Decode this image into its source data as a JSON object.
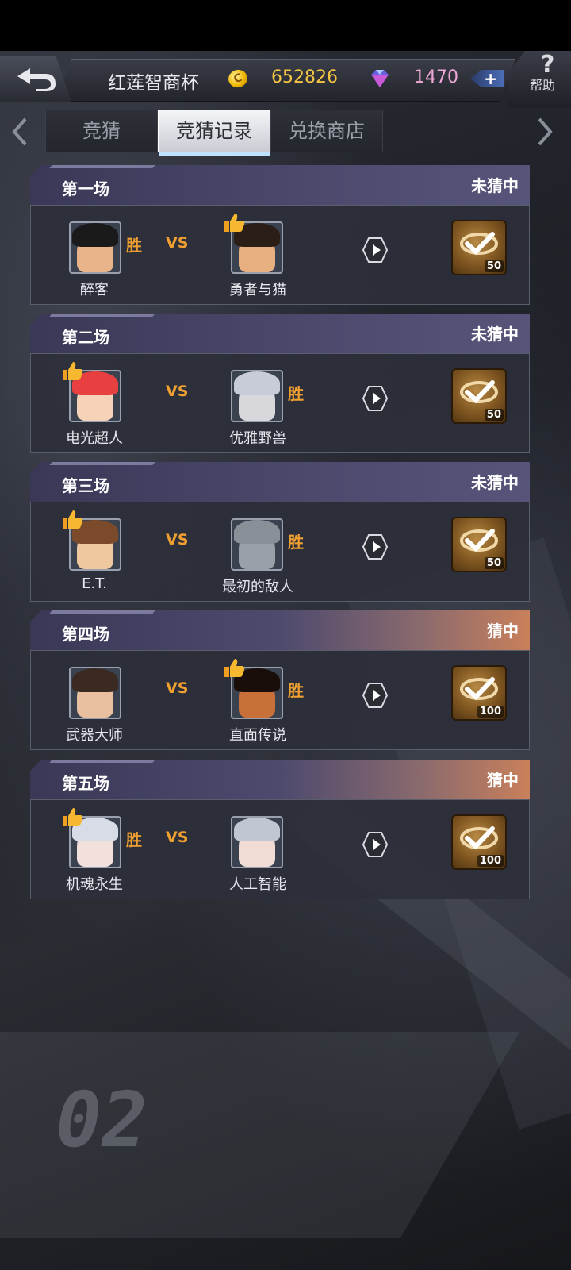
{
  "header": {
    "event_title": "红莲智商杯",
    "coins": "652826",
    "gems": "1470",
    "plus_label": "+",
    "help_label": "帮助",
    "help_symbol": "?"
  },
  "tabs": [
    {
      "label": "竞猜",
      "active": false
    },
    {
      "label": "竞猜记录",
      "active": true
    },
    {
      "label": "兑换商店",
      "active": false
    }
  ],
  "vs_label": "VS",
  "win_label": "胜",
  "matches": [
    {
      "label": "第一场",
      "status": "未猜中",
      "hit": false,
      "team_a": "醉客",
      "team_b": "勇者与猫",
      "winner": "a",
      "pick": "b",
      "reward": "50"
    },
    {
      "label": "第二场",
      "status": "未猜中",
      "hit": false,
      "team_a": "电光超人",
      "team_b": "优雅野兽",
      "winner": "b",
      "pick": "a",
      "reward": "50"
    },
    {
      "label": "第三场",
      "status": "未猜中",
      "hit": false,
      "team_a": "E.T.",
      "team_b": "最初的敌人",
      "winner": "b",
      "pick": "a",
      "reward": "50"
    },
    {
      "label": "第四场",
      "status": "猜中",
      "hit": true,
      "team_a": "武器大师",
      "team_b": "直面传说",
      "winner": "b",
      "pick": "b",
      "reward": "100"
    },
    {
      "label": "第五场",
      "status": "猜中",
      "hit": true,
      "team_a": "机魂永生",
      "team_b": "人工智能",
      "winner": "a",
      "pick": "a",
      "reward": "100"
    }
  ],
  "colors": {
    "accent_orange": "#f0a030",
    "coin_yellow": "#f3c542",
    "gem_pink": "#f0a8d8"
  },
  "background_text": "02"
}
